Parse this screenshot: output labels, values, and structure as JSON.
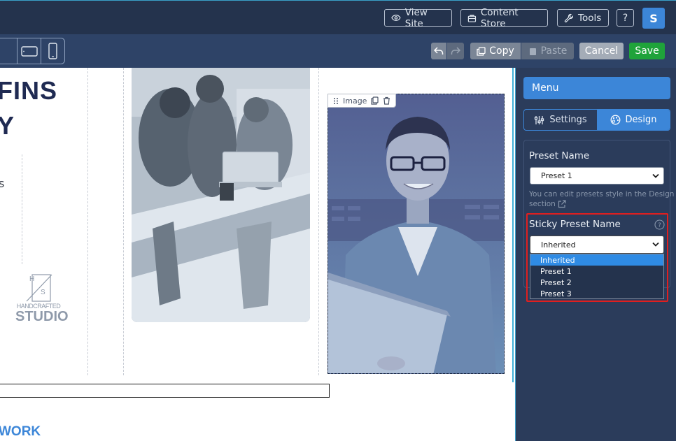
{
  "topbar": {
    "view_site": "View Site",
    "content_store": "Content Store",
    "tools": "Tools",
    "help": "?",
    "avatar": "S"
  },
  "toolbar": {
    "copy": "Copy",
    "paste": "Paste",
    "cancel": "Cancel",
    "save": "Save"
  },
  "canvas": {
    "headline_line1": "FINS",
    "headline_line2": "Y",
    "partial_text": "s",
    "logo_top": "H",
    "logo_bottom": "S",
    "logo_line1": "HANDCRAFTED",
    "logo_line2": "STUDIO",
    "image_tag": "Image",
    "footer_text": "WORK"
  },
  "sidebar": {
    "menu_title": "Menu",
    "tab_settings": "Settings",
    "tab_design": "Design",
    "preset_name_label": "Preset Name",
    "preset_name_value": "Preset 1",
    "hint_line1": "You can edit presets style in the Design",
    "hint_line2": "section",
    "sticky_label": "Sticky Preset Name",
    "sticky_value": "Inherited",
    "options": [
      "Inherited",
      "Preset 1",
      "Preset 2",
      "Preset 3"
    ]
  },
  "colors": {
    "topbar_bg": "#24334d",
    "toolbar_bg": "#2e4367",
    "accent_blue": "#3c86d8",
    "save_green": "#1fa33a",
    "highlight_red": "#e01f1f",
    "headline_navy": "#1f2a52",
    "footer_blue": "#3c86d8"
  }
}
